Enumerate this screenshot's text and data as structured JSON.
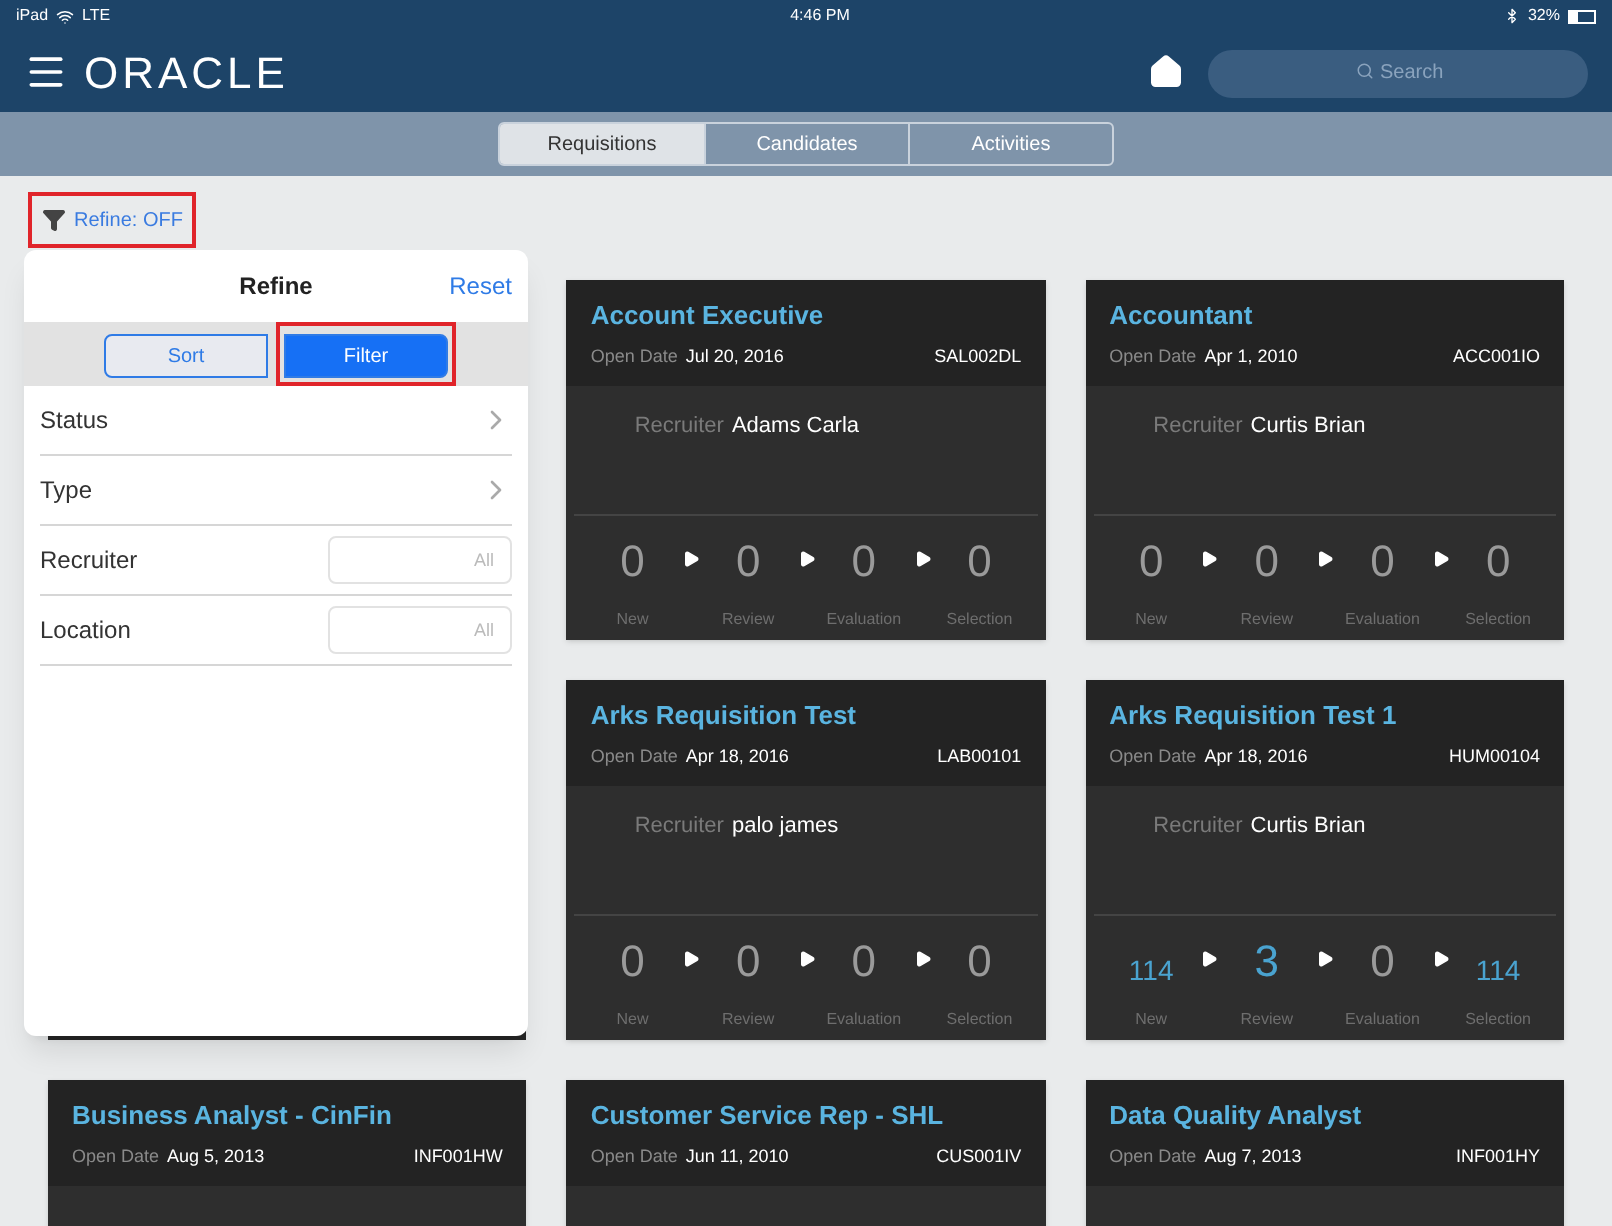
{
  "status_bar": {
    "device": "iPad",
    "network": "LTE",
    "time": "4:46 PM",
    "battery": "32%"
  },
  "header": {
    "logo": "ORACLE",
    "search": {
      "placeholder": "Search"
    }
  },
  "tabs": [
    {
      "label": "Requisitions",
      "selected": true
    },
    {
      "label": "Candidates",
      "selected": false
    },
    {
      "label": "Activities",
      "selected": false
    }
  ],
  "refine_button": {
    "label": "Refine: OFF",
    "highlighted": true
  },
  "refine_panel": {
    "title": "Refine",
    "reset": "Reset",
    "segments": [
      {
        "label": "Sort",
        "selected": false,
        "highlighted": false
      },
      {
        "label": "Filter",
        "selected": true,
        "highlighted": true
      }
    ],
    "rows": [
      {
        "kind": "chevron",
        "label": "Status"
      },
      {
        "kind": "chevron",
        "label": "Type"
      },
      {
        "kind": "field",
        "label": "Recruiter",
        "placeholder": "All"
      },
      {
        "kind": "field",
        "label": "Location",
        "placeholder": "All"
      }
    ]
  },
  "cards": [
    {
      "title": "Account Executive",
      "open_date_label": "Open Date",
      "open_date": "Jul 20, 2016",
      "code": "SAL002DL",
      "recruiter_label": "Recruiter",
      "recruiter": "Adams Carla",
      "stages": [
        {
          "count": "0",
          "label": "New",
          "highlighted": false
        },
        {
          "count": "0",
          "label": "Review",
          "highlighted": false
        },
        {
          "count": "0",
          "label": "Evaluation",
          "highlighted": false
        },
        {
          "count": "0",
          "label": "Selection",
          "highlighted": false
        }
      ]
    },
    {
      "title": "Accountant",
      "open_date_label": "Open Date",
      "open_date": "Apr 1, 2010",
      "code": "ACC001IO",
      "recruiter_label": "Recruiter",
      "recruiter": "Curtis Brian",
      "stages": [
        {
          "count": "0",
          "label": "New",
          "highlighted": false
        },
        {
          "count": "0",
          "label": "Review",
          "highlighted": false
        },
        {
          "count": "0",
          "label": "Evaluation",
          "highlighted": false
        },
        {
          "count": "0",
          "label": "Selection",
          "highlighted": false
        }
      ]
    },
    {
      "title": "Arks Requisition Test",
      "open_date_label": "Open Date",
      "open_date": "Apr 18, 2016",
      "code": "LAB00101",
      "recruiter_label": "Recruiter",
      "recruiter": "palo james",
      "stages": [
        {
          "count": "0",
          "label": "New",
          "highlighted": false
        },
        {
          "count": "0",
          "label": "Review",
          "highlighted": false
        },
        {
          "count": "0",
          "label": "Evaluation",
          "highlighted": false
        },
        {
          "count": "0",
          "label": "Selection",
          "highlighted": false
        }
      ]
    },
    {
      "title": "Arks Requisition Test 1",
      "open_date_label": "Open Date",
      "open_date": "Apr 18, 2016",
      "code": "HUM00104",
      "recruiter_label": "Recruiter",
      "recruiter": "Curtis Brian",
      "stages": [
        {
          "count": "114",
          "label": "New",
          "highlighted": true
        },
        {
          "count": "3",
          "label": "Review",
          "highlighted": true
        },
        {
          "count": "0",
          "label": "Evaluation",
          "highlighted": false
        },
        {
          "count": "114",
          "label": "Selection",
          "highlighted": true
        }
      ]
    },
    {
      "title": "Business Analyst - CinFin",
      "open_date_label": "Open Date",
      "open_date": "Aug 5, 2013",
      "code": "INF001HW"
    },
    {
      "title": "Customer Service Rep - SHL",
      "open_date_label": "Open Date",
      "open_date": "Jun 11, 2010",
      "code": "CUS001IV"
    },
    {
      "title": "Data Quality Analyst",
      "open_date_label": "Open Date",
      "open_date": "Aug 7, 2013",
      "code": "INF001HY"
    }
  ]
}
